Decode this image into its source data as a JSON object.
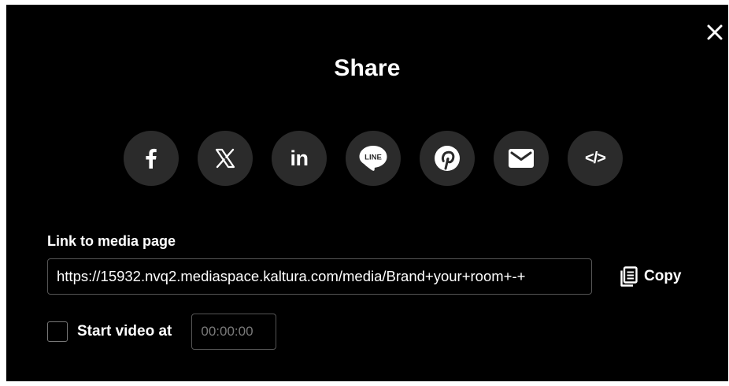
{
  "dialog": {
    "title": "Share",
    "close_icon": "close-icon"
  },
  "social": [
    {
      "name": "facebook",
      "icon": "facebook-icon"
    },
    {
      "name": "x",
      "icon": "x-icon"
    },
    {
      "name": "linkedin",
      "icon": "linkedin-icon",
      "text": "in"
    },
    {
      "name": "line",
      "icon": "line-icon",
      "text": "LINE"
    },
    {
      "name": "pinterest",
      "icon": "pinterest-icon"
    },
    {
      "name": "email",
      "icon": "email-icon"
    },
    {
      "name": "embed",
      "icon": "embed-code-icon",
      "text": "</>"
    }
  ],
  "link": {
    "label": "Link to media page",
    "value": "https://15932.nvq2.mediaspace.kaltura.com/media/Brand+your+room+-+",
    "copy_label": "Copy",
    "copy_icon": "copy-icon"
  },
  "start_video": {
    "label": "Start video at",
    "checked": false,
    "time_placeholder": "00:00:00"
  },
  "colors": {
    "background": "#000000",
    "button_bg": "#2b2b2b",
    "text": "#ffffff",
    "border": "#555555"
  }
}
